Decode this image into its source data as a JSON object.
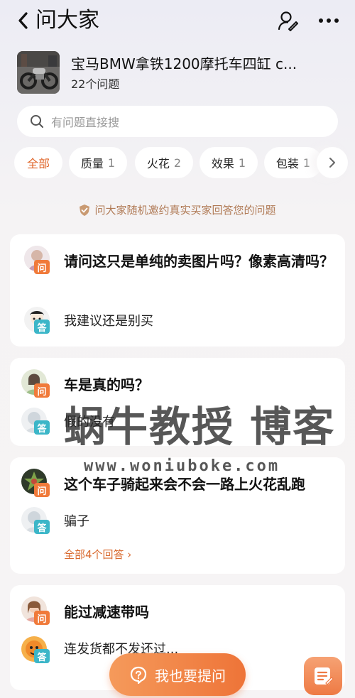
{
  "header": {
    "title": "问大家",
    "back_icon": "chevron-left-icon",
    "profile_icon": "user-edit-icon",
    "more_icon": "more-dots-icon"
  },
  "product": {
    "name": "宝马BMW拿铁1200摩托车四缸 c...",
    "count": "22个问题"
  },
  "search": {
    "placeholder": "有问题直接搜"
  },
  "chips": [
    {
      "label": "全部",
      "count": ""
    },
    {
      "label": "质量",
      "count": "1"
    },
    {
      "label": "火花",
      "count": "2"
    },
    {
      "label": "效果",
      "count": "1"
    },
    {
      "label": "包装",
      "count": "1"
    }
  ],
  "notice": "问大家随机邀约真实买家回答您的问题",
  "badges": {
    "question": "问",
    "answer": "答"
  },
  "questions": [
    {
      "question": "请问这只是单纯的卖图片吗？像素高清吗？",
      "answer": "我建议还是别买",
      "all_answers": ""
    },
    {
      "question": "车是真的吗？",
      "answer": "假的没有",
      "all_answers": ""
    },
    {
      "question": "这个车子骑起来会不会一路上火花乱跑",
      "answer": "骗子",
      "all_answers": "全部4个回答 ›"
    },
    {
      "question": "能过减速带吗",
      "answer": "连发货都不发还过...",
      "all_answers": ""
    }
  ],
  "ask_button": "我也要提问",
  "watermark": {
    "line1": "蜗牛教授 博客",
    "line2": "www.woniuboke.com"
  },
  "colors": {
    "accent": "#ee7438",
    "answer_badge": "#3cb6c8",
    "notice": "#b07a55"
  }
}
